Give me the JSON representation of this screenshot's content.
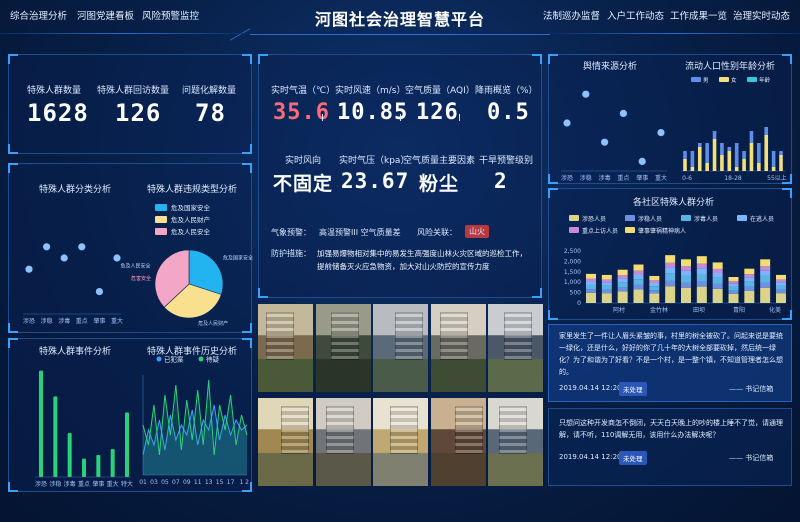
{
  "header": {
    "title": "河图社会治理智慧平台",
    "nav_left": [
      "综合治理分析",
      "河图党建看板",
      "风险预警监控"
    ],
    "nav_right": [
      "法制巡办监督",
      "入户工作动态",
      "工作成果一览",
      "治理实时动态"
    ]
  },
  "stats": [
    {
      "label": "特殊人群数量",
      "value": "1628"
    },
    {
      "label": "特殊人群回访数量",
      "value": "126"
    },
    {
      "label": "问题化解数量",
      "value": "78"
    }
  ],
  "weather": {
    "row1": [
      {
        "label": "实时气温（℃）",
        "value": "35.6",
        "unit": "I",
        "color": "#ff6b7a"
      },
      {
        "label": "实时风速（m/s）",
        "value": "10.85",
        "unit": "I",
        "color": "#ffffff"
      },
      {
        "label": "空气质量（AQI）",
        "value": "126",
        "unit": "I",
        "color": "#ffffff"
      },
      {
        "label": "降雨概览（%）",
        "value": "0.5",
        "unit": "",
        "color": "#ffffff"
      }
    ],
    "row2": [
      {
        "label": "实时风向",
        "value": "不固定"
      },
      {
        "label": "实时气压（kpa）",
        "value": "23.67"
      },
      {
        "label": "空气质量主要因素",
        "value": "粉尘"
      },
      {
        "label": "干旱预警级别",
        "value": "2"
      }
    ],
    "alert_label": "气象预警：",
    "alert_value": "高温预警III 空气质量差",
    "risk_label": "风险关联：",
    "risk_value": "山火",
    "measure_label": "防护措施：",
    "measure_text_1": "加强易爆物相对集中的易发生高强度山林火灾区域的巡检工作，",
    "measure_text_2": "提前储备灭火应急物资，加大对山火防控的宣传力度"
  },
  "panels": {
    "special_group_analysis": "特殊人群分类分析",
    "violation_type": "特殊人群违规类型分析",
    "event_analysis": "特殊人群事件分析",
    "event_history": "特殊人群事件历史分析",
    "complaint_source": "舆情来源分析",
    "floating_population": "流动人口性别年龄分析",
    "district_group": "各社区特殊人群分析"
  },
  "chart_data": [
    {
      "type": "scatter",
      "title": "特殊人群分类分析",
      "categories": [
        "涉恐",
        "涉稳",
        "涉毒",
        "重点",
        "肇事",
        "重大"
      ],
      "values": [
        4,
        6,
        5,
        6,
        2,
        5
      ],
      "ylim": [
        0,
        10
      ]
    },
    {
      "type": "pie",
      "title": "特殊人群违规类型分析",
      "legend": [
        "危及国家安全",
        "危及人民财产",
        "危及人民安全"
      ],
      "slice_labels": [
        "危及国家安全",
        "危及人民财产",
        "危及人民安全"
      ],
      "values": [
        30,
        33,
        37
      ],
      "colors": [
        "#21b4f0",
        "#f8e08e",
        "#f4a6c6"
      ],
      "small_label": "危害安全"
    },
    {
      "type": "bar",
      "title": "特殊人群事件分析",
      "categories": [
        "涉恐",
        "涉稳",
        "涉毒",
        "重点",
        "肇事",
        "重大",
        "特大"
      ],
      "values": [
        1450,
        1100,
        600,
        250,
        300,
        380,
        880
      ],
      "ylim": [
        0,
        1500
      ]
    },
    {
      "type": "line",
      "title": "特殊人群事件历史分析",
      "legend": [
        "已犯案",
        "待疑"
      ],
      "x": [
        "01",
        "02",
        "03",
        "04",
        "05",
        "06",
        "07",
        "08",
        "09",
        "10",
        "11",
        "12",
        "13",
        "14",
        "15",
        "16",
        "17",
        "18",
        "1",
        "2"
      ],
      "series": [
        {
          "name": "已犯案",
          "values": [
            20,
            45,
            30,
            55,
            25,
            60,
            35,
            50,
            40,
            65,
            30,
            55,
            45,
            70,
            35,
            60,
            40,
            55,
            45,
            50
          ]
        },
        {
          "name": "待疑",
          "values": [
            50,
            30,
            70,
            20,
            80,
            40,
            90,
            25,
            75,
            35,
            85,
            30,
            95,
            20,
            70,
            45,
            80,
            30,
            60,
            40
          ]
        }
      ],
      "ylim": [
        0,
        100
      ]
    },
    {
      "type": "scatter",
      "title": "舆情来源分析",
      "categories": [
        "涉恐",
        "涉稳",
        "涉毒",
        "重点",
        "肇事",
        "重大"
      ],
      "values": [
        5,
        8,
        3,
        6,
        1,
        4
      ],
      "ylim": [
        0,
        10
      ]
    },
    {
      "type": "bar",
      "title": "流动人口性别年龄分析",
      "legend": [
        "男",
        "女",
        "年龄"
      ],
      "categories": [
        "0-6",
        "18-28",
        "55以上"
      ],
      "series": [
        {
          "name": "男",
          "values": [
            3,
            1,
            6,
            2,
            8,
            4,
            5,
            1,
            3,
            7,
            2,
            9,
            1,
            4
          ]
        },
        {
          "name": "女",
          "values": [
            2,
            4,
            1,
            5,
            2,
            3,
            1,
            6,
            2,
            3,
            5,
            2,
            4,
            1
          ]
        }
      ],
      "ylim": [
        0,
        15
      ]
    },
    {
      "type": "bar",
      "title": "各社区特殊人群分析",
      "legend": [
        "涉恐人员",
        "涉稳人员",
        "涉毒人员",
        "在逃人员",
        "重点上访人员",
        "肇事肇祸精神病人"
      ],
      "colors": [
        "#d9d48a",
        "#6f8fe0",
        "#5bb4e6",
        "#7ab6ff",
        "#c78ad8",
        "#f2dd73"
      ],
      "categories": [
        "阿村",
        "金竹林",
        "田坝",
        "青阳",
        "化美"
      ],
      "x": [
        "a1",
        "a2",
        "b1",
        "b2",
        "b3",
        "c1",
        "c2",
        "c3",
        "d1",
        "d2",
        "d3",
        "e1",
        "e2"
      ],
      "stack_totals": [
        1400,
        1350,
        1600,
        1850,
        1300,
        2300,
        2100,
        2250,
        1950,
        1250,
        1650,
        2100,
        1350
      ],
      "ylim": [
        0,
        2500
      ],
      "yticks": [
        "0",
        "500",
        "1,000",
        "1,500",
        "2,000",
        "2,500"
      ]
    }
  ],
  "messages": [
    {
      "text": "家里发生了一件让人眉头紧皱的事，村里的树全被砍了。问起来说是要统一绿化，还是什么，好好的你了几十年的大树全部要砍掉，然后统一绿化？为了和谐为了好看？不是一个村，是一整个镇，不知道管理者怎么想的。",
      "time": "2019.04.14 12:20",
      "status": "未处理",
      "author": "—— 书记信箱"
    },
    {
      "text": "只想问这种开发商怎不倒闭，天天白天晚上的吵的楼上睡不了觉，请通理解，请不听，110调解无用，该用什么办法解决呢？",
      "time": "2019.04.14 12:20",
      "status": "未处理",
      "author": "—— 书记信箱"
    }
  ],
  "colors": {
    "accent": "#3aa0ff",
    "bar_green": "#28d27a",
    "risk_badge": "#b83840"
  }
}
